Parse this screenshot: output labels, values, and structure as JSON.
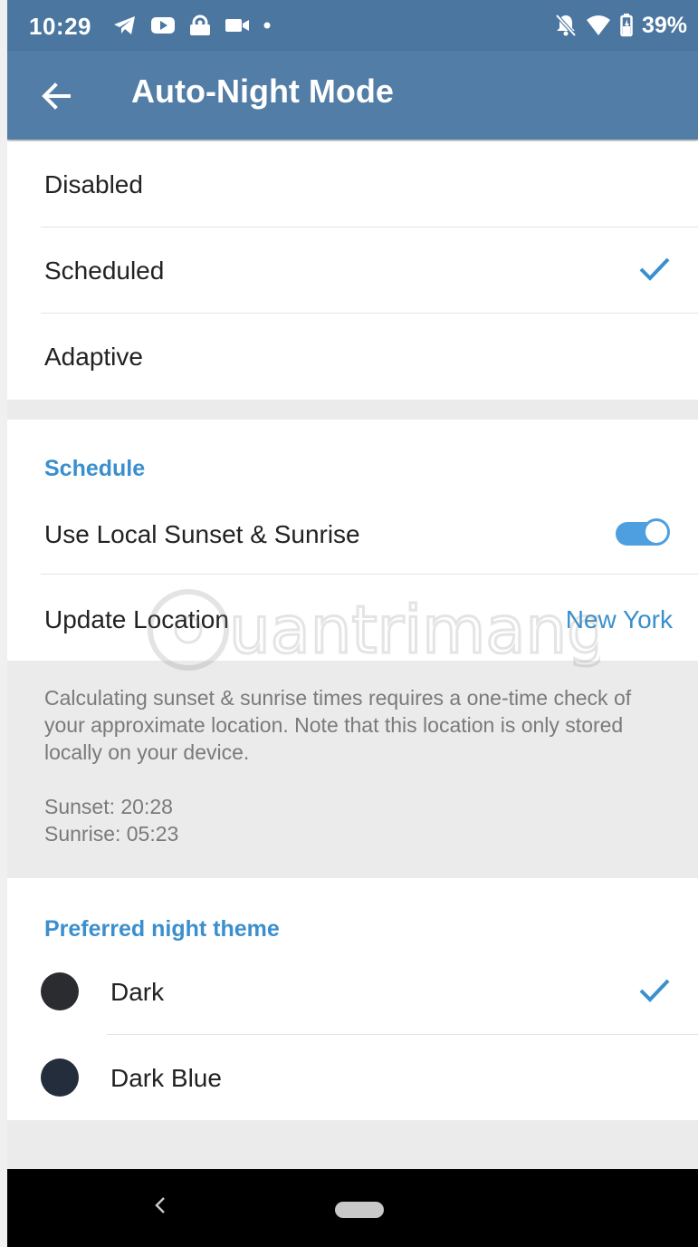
{
  "status_bar": {
    "time": "10:29",
    "battery": "39%",
    "left_icons": [
      "telegram-icon",
      "youtube-icon",
      "alarm-icon",
      "video-camera-icon",
      "dot-icon"
    ],
    "right_icons": [
      "bell-off-icon",
      "wifi-icon",
      "battery-icon"
    ]
  },
  "app_bar": {
    "title": "Auto-Night Mode",
    "back_icon": "back-arrow-icon"
  },
  "mode_options": [
    {
      "label": "Disabled",
      "selected": false
    },
    {
      "label": "Scheduled",
      "selected": true
    },
    {
      "label": "Adaptive",
      "selected": false
    }
  ],
  "schedule": {
    "header": "Schedule",
    "use_local_label": "Use Local Sunset & Sunrise",
    "use_local_enabled": true,
    "update_location_label": "Update Location",
    "location_value": "New York",
    "info_text": "Calculating sunset & sunrise times requires a one-time check of your approximate location. Note that this location is only stored locally on your device.",
    "sunset": "Sunset: 20:28",
    "sunrise": "Sunrise: 05:23"
  },
  "night_theme": {
    "header": "Preferred night theme",
    "options": [
      {
        "label": "Dark",
        "selected": true,
        "color": "#2a2c30"
      },
      {
        "label": "Dark Blue",
        "selected": false,
        "color": "#232d3b"
      }
    ]
  },
  "watermark_text": "uantrimang",
  "colors": {
    "app_bar": "#527da6",
    "status_bar": "#4a76a0",
    "accent": "#3a8fce",
    "toggle": "#4d9fe0"
  }
}
